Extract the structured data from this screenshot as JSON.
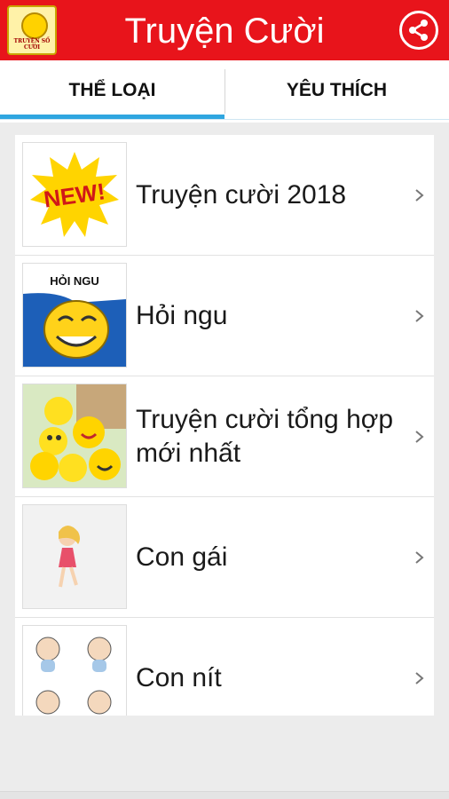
{
  "app": {
    "title": "Truyện Cười",
    "logo_text": "TRUYỆN SỐ CƯỜI",
    "brand_color": "#e8141b",
    "accent_color": "#2fa6e0"
  },
  "tabs": [
    {
      "label": "THỂ LOẠI",
      "selected": true
    },
    {
      "label": "YÊU THÍCH",
      "selected": false
    }
  ],
  "categories": [
    {
      "label": "Truyện cười 2018",
      "icon": "new-burst-icon",
      "thumb_text": "NEW!"
    },
    {
      "label": "Hỏi ngu",
      "icon": "troll-face-icon",
      "thumb_text": "HỎI NGU"
    },
    {
      "label": "Truyện cười tổng hợp mới nhất",
      "icon": "emoji-balls-icon"
    },
    {
      "label": "Con gái",
      "icon": "cartoon-girl-icon"
    },
    {
      "label": "Con nít",
      "icon": "cartoon-babies-icon"
    }
  ]
}
